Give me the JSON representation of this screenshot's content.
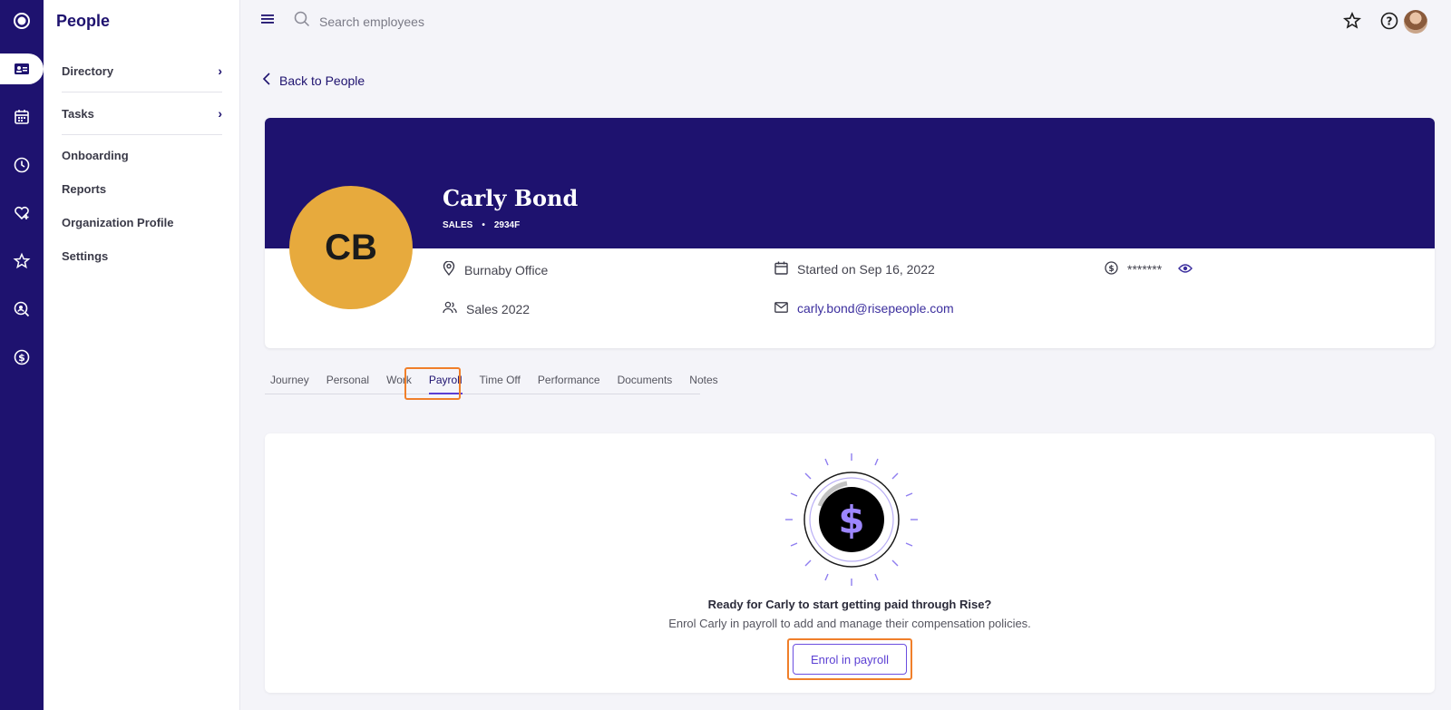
{
  "app": {
    "section_title": "People"
  },
  "rail": {
    "items": [
      {
        "icon": "logo-icon"
      },
      {
        "icon": "id-card-icon",
        "active": true
      },
      {
        "icon": "calendar-icon"
      },
      {
        "icon": "clock-icon"
      },
      {
        "icon": "heart-plus-icon"
      },
      {
        "icon": "star-icon"
      },
      {
        "icon": "person-search-icon"
      },
      {
        "icon": "dollar-icon"
      }
    ]
  },
  "sidenav": {
    "items": [
      {
        "label": "Directory"
      },
      {
        "label": "Tasks"
      },
      {
        "label": "Onboarding"
      },
      {
        "label": "Reports"
      },
      {
        "label": "Organization Profile"
      },
      {
        "label": "Settings"
      }
    ]
  },
  "search": {
    "placeholder": "Search employees"
  },
  "back_link": {
    "label": "Back to People"
  },
  "profile": {
    "initials": "CB",
    "name": "Carly Bond",
    "department": "SALES",
    "separator": "•",
    "employee_id": "2934F",
    "location": "Burnaby Office",
    "start_date": "Started on Sep 16, 2022",
    "salary_masked": "*******",
    "team": "Sales 2022",
    "email": "carly.bond@risepeople.com"
  },
  "tabs": [
    {
      "label": "Journey"
    },
    {
      "label": "Personal"
    },
    {
      "label": "Work"
    },
    {
      "label": "Payroll",
      "active": true
    },
    {
      "label": "Time Off"
    },
    {
      "label": "Performance"
    },
    {
      "label": "Documents"
    },
    {
      "label": "Notes"
    }
  ],
  "payroll": {
    "title": "Ready for Carly to start getting paid through Rise?",
    "description": "Enrol Carly in payroll to add and manage their compensation policies.",
    "button_label": "Enrol in payroll"
  },
  "colors": {
    "brand": "#1e126f",
    "accent": "#5b3fd3",
    "avatar": "#e7aa3d",
    "highlight": "#f07f2a"
  }
}
